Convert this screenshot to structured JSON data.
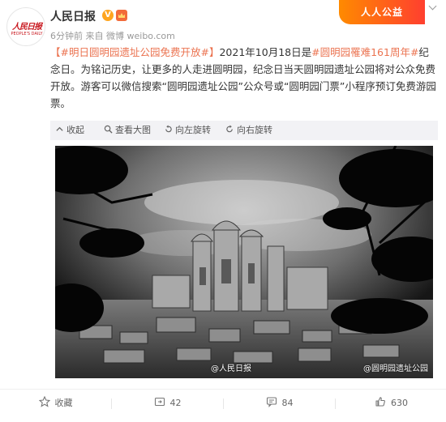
{
  "header": {
    "avatar_text": "人民日报",
    "avatar_subtext": "PEOPLE'S DAILY",
    "username": "人民日报",
    "vip_icon": "verified-badge-icon",
    "meta_time": "6分钟前",
    "meta_from": "来自",
    "meta_source": "微博 weibo.com",
    "banner_label": "人人公益"
  },
  "post": {
    "tag_open": "【",
    "topic1": "#明日圆明园遗址公园免费开放#",
    "tag_close": "】",
    "text1": "2021年10月18日是",
    "topic2": "#圆明园罹难161周年#",
    "text2": "纪念日。为铭记历史，让更多的人走进圆明园，纪念日当天圆明园遗址公园将对公众免费开放。游客可以微信搜索“圆明园遗址公园”公众号或“圆明园门票”小程序预订免费游园票。"
  },
  "toolbar": {
    "collapse": "收起",
    "view_large": "查看大图",
    "rotate_left": "向左旋转",
    "rotate_right": "向右旋转"
  },
  "image": {
    "watermark_left": "@人民日报",
    "watermark_right": "@圆明园遗址公园"
  },
  "actions": {
    "favorite": "收藏",
    "repost": "42",
    "comment": "84",
    "like": "630"
  }
}
